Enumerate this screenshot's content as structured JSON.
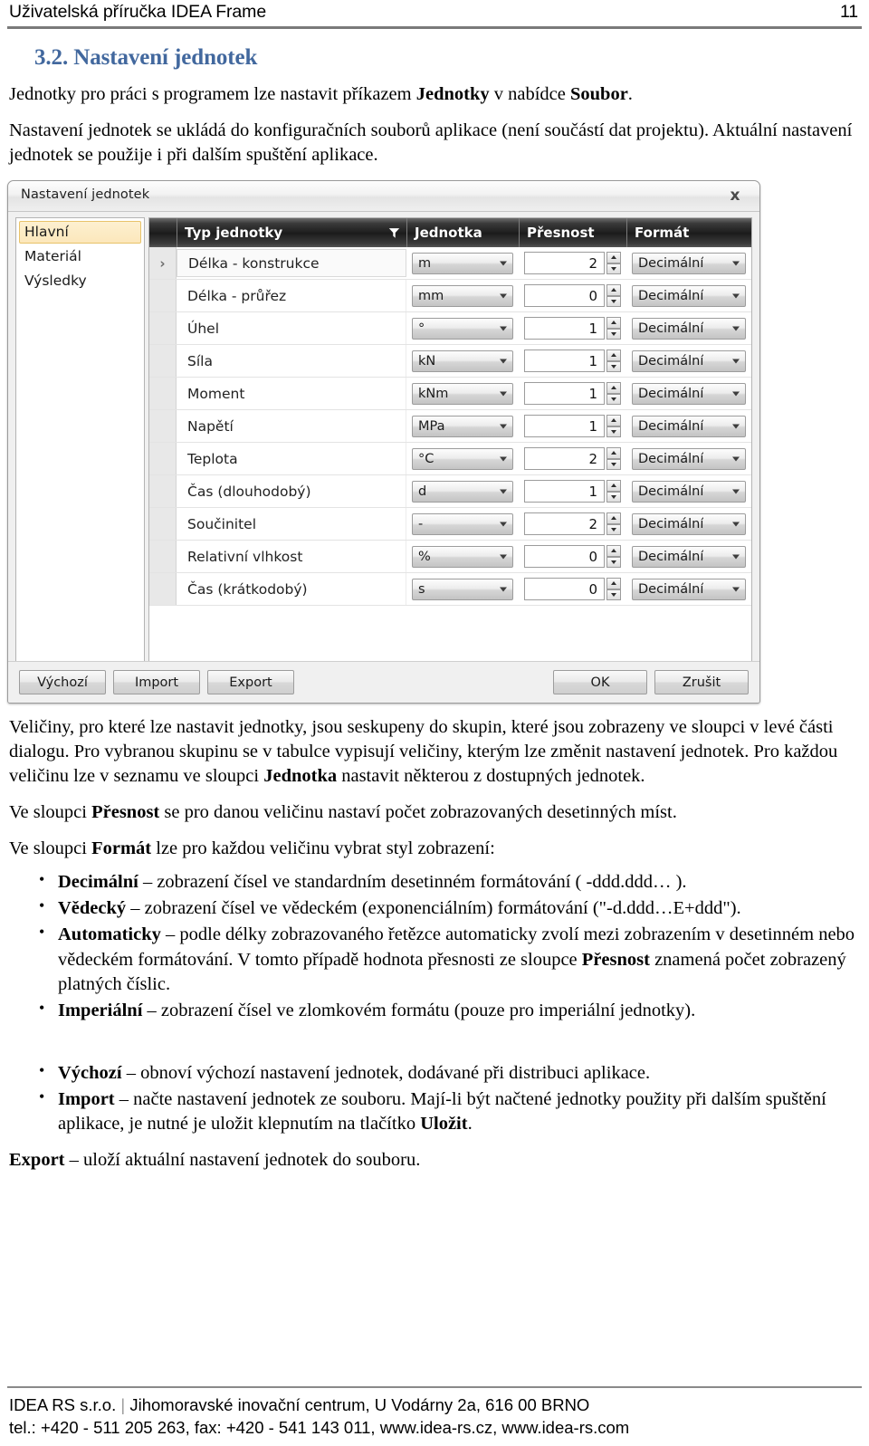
{
  "header": {
    "title": "Uživatelská příručka IDEA Frame",
    "page_number": "11"
  },
  "section": {
    "number": "3.2.",
    "heading": "3.2. Nastavení jednotek"
  },
  "intro": {
    "p1_a": "Jednotky pro práci s programem lze nastavit příkazem ",
    "p1_b": "Jednotky",
    "p1_c": " v nabídce ",
    "p1_d": "Soubor",
    "p1_e": ".",
    "p2": "Nastavení jednotek se ukládá do konfiguračních souborů aplikace (není součástí dat projektu). Aktuální nastavení jednotek se použije i při dalším spuštění aplikace."
  },
  "dialog": {
    "title": "Nastavení jednotek",
    "close_label": "x",
    "groups": [
      {
        "label": "Hlavní",
        "selected": true
      },
      {
        "label": "Materiál",
        "selected": false
      },
      {
        "label": "Výsledky",
        "selected": false
      }
    ],
    "columns": {
      "indicator": "",
      "type": "Typ jednotky",
      "unit": "Jednotka",
      "precision": "Přesnost",
      "format": "Formát"
    },
    "rows": [
      {
        "indicator": "›",
        "type": "Délka - konstrukce",
        "unit": "m",
        "precision": "2",
        "format": "Decimální",
        "current": true
      },
      {
        "indicator": "",
        "type": "Délka - průřez",
        "unit": "mm",
        "precision": "0",
        "format": "Decimální",
        "current": false
      },
      {
        "indicator": "",
        "type": "Úhel",
        "unit": "°",
        "precision": "1",
        "format": "Decimální",
        "current": false
      },
      {
        "indicator": "",
        "type": "Síla",
        "unit": "kN",
        "precision": "1",
        "format": "Decimální",
        "current": false
      },
      {
        "indicator": "",
        "type": "Moment",
        "unit": "kNm",
        "precision": "1",
        "format": "Decimální",
        "current": false
      },
      {
        "indicator": "",
        "type": "Napětí",
        "unit": "MPa",
        "precision": "1",
        "format": "Decimální",
        "current": false
      },
      {
        "indicator": "",
        "type": "Teplota",
        "unit": "°C",
        "precision": "2",
        "format": "Decimální",
        "current": false
      },
      {
        "indicator": "",
        "type": "Čas (dlouhodobý)",
        "unit": "d",
        "precision": "1",
        "format": "Decimální",
        "current": false
      },
      {
        "indicator": "",
        "type": "Součinitel",
        "unit": "-",
        "precision": "2",
        "format": "Decimální",
        "current": false
      },
      {
        "indicator": "",
        "type": "Relativní vlhkost",
        "unit": "%",
        "precision": "0",
        "format": "Decimální",
        "current": false
      },
      {
        "indicator": "",
        "type": "Čas (krátkodobý)",
        "unit": "s",
        "precision": "0",
        "format": "Decimální",
        "current": false
      }
    ],
    "buttons": {
      "default": "Výchozí",
      "import": "Import",
      "export": "Export",
      "ok": "OK",
      "cancel": "Zrušit"
    }
  },
  "description": {
    "p1_a": "Veličiny, pro které lze nastavit jednotky, jsou seskupeny do skupin, které jsou zobrazeny ve sloupci v levé části dialogu. Pro vybranou skupinu se v tabulce vypisují veličiny, kterým lze změnit nastavení jednotek. Pro každou veličinu lze v seznamu ve sloupci ",
    "p1_b": "Jednotka",
    "p1_c": " nastavit některou z dostupných jednotek.",
    "p2_a": "Ve sloupci ",
    "p2_b": "Přesnost",
    "p2_c": " se pro danou veličinu nastaví počet zobrazovaných desetinných míst.",
    "p3_a": "Ve sloupci ",
    "p3_b": "Formát",
    "p3_c": " lze pro každou veličinu vybrat styl zobrazení:"
  },
  "format_bullets": [
    {
      "term": "Decimální",
      "text": " – zobrazení čísel ve standardním desetinném formátování ( -ddd.ddd… )."
    },
    {
      "term": "Vědecký",
      "text": " – zobrazení čísel ve vědeckém (exponenciálním) formátování (\"-d.ddd…E+ddd\")."
    },
    {
      "term": "Automaticky",
      "text_a": " – podle délky zobrazovaného řetězce automaticky zvolí mezi zobrazením v desetinném nebo vědeckém formátování. V tomto případě hodnota přesnosti ze sloupce ",
      "term2": "Přesnost",
      "text_b": " znamená počet zobrazený platných číslic."
    },
    {
      "term": "Imperiální",
      "text": " – zobrazení čísel ve zlomkovém formátu (pouze pro imperiální jednotky)."
    }
  ],
  "action_bullets": [
    {
      "term": "Výchozí",
      "text": " – obnoví výchozí nastavení jednotek, dodávané při distribuci aplikace."
    },
    {
      "term": "Import",
      "text_a": " – načte nastavení jednotek ze souboru. Mají-li být načtené jednotky použity při dalším spuštění aplikace, je nutné je uložit klepnutím na tlačítko ",
      "term2": "Uložit",
      "text_b": "."
    }
  ],
  "export_paragraph": {
    "term": "Export",
    "text": " – uloží aktuální nastavení jednotek do souboru."
  },
  "footer": {
    "line1_a": "IDEA RS s.r.o.",
    "line1_sep": " | ",
    "line1_b": "Jihomoravské inovační centrum, U Vodárny 2a, 616 00 BRNO",
    "line2": "tel.: +420 - 511 205 263, fax: +420 - 541 143 011, www.idea-rs.cz, www.idea-rs.com"
  },
  "colors": {
    "heading": "#42689e",
    "selected_row": "#fce7bb",
    "grid_header": "#1c1c1c"
  }
}
